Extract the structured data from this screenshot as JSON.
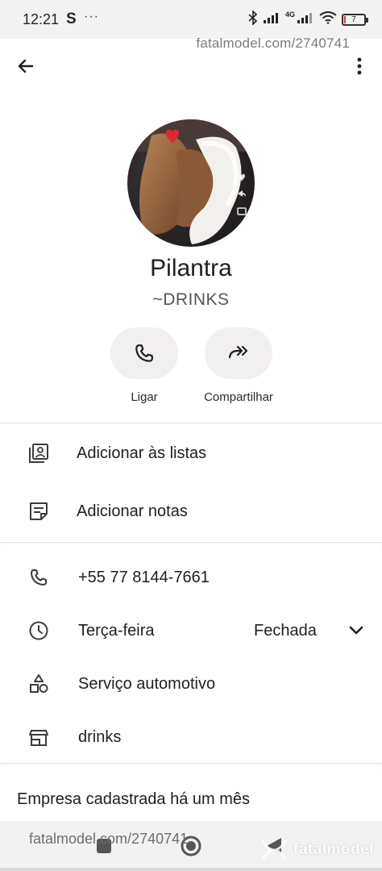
{
  "status_bar": {
    "time": "12:21",
    "app_badge": "S",
    "more": "···",
    "network_label": "4G",
    "battery_level": "7"
  },
  "watermark": {
    "top": "fatalmodel.com/2740741",
    "bottom": "fatalmodel.com/2740741",
    "brand": "fatalmodel"
  },
  "profile": {
    "name": "Pilantra",
    "subtitle": "~DRINKS"
  },
  "actions": [
    {
      "label": "Ligar",
      "icon": "phone-icon"
    },
    {
      "label": "Compartilhar",
      "icon": "share-icon"
    }
  ],
  "menu": {
    "add_to_lists": "Adicionar às listas",
    "add_notes": "Adicionar notas"
  },
  "details": {
    "phone": "+55 77 8144-7661",
    "day": "Terça-feira",
    "hours_status": "Fechada",
    "category": "Serviço automotivo",
    "store": "drinks"
  },
  "footer": {
    "registered": "Empresa cadastrada há um mês"
  },
  "colors": {
    "accent_bg": "#f1efef",
    "text": "#1f1f1f",
    "battery_low": "#e53935"
  }
}
